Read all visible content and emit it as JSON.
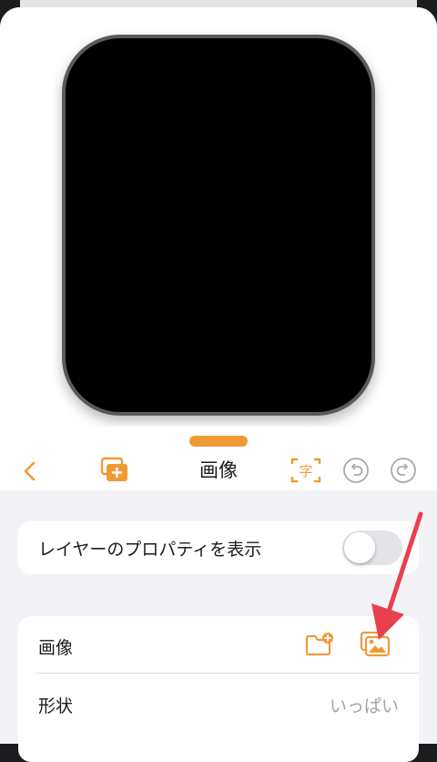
{
  "toolbar": {
    "title": "画像",
    "text_button_glyph": "字"
  },
  "layer_properties": {
    "label": "レイヤーのプロパティを表示",
    "toggle_on": false
  },
  "image_settings": {
    "image_label": "画像",
    "shape_label": "形状",
    "shape_value": "いっぱい"
  },
  "colors": {
    "accent": "#f09a37",
    "arrow": "#e8414e"
  }
}
